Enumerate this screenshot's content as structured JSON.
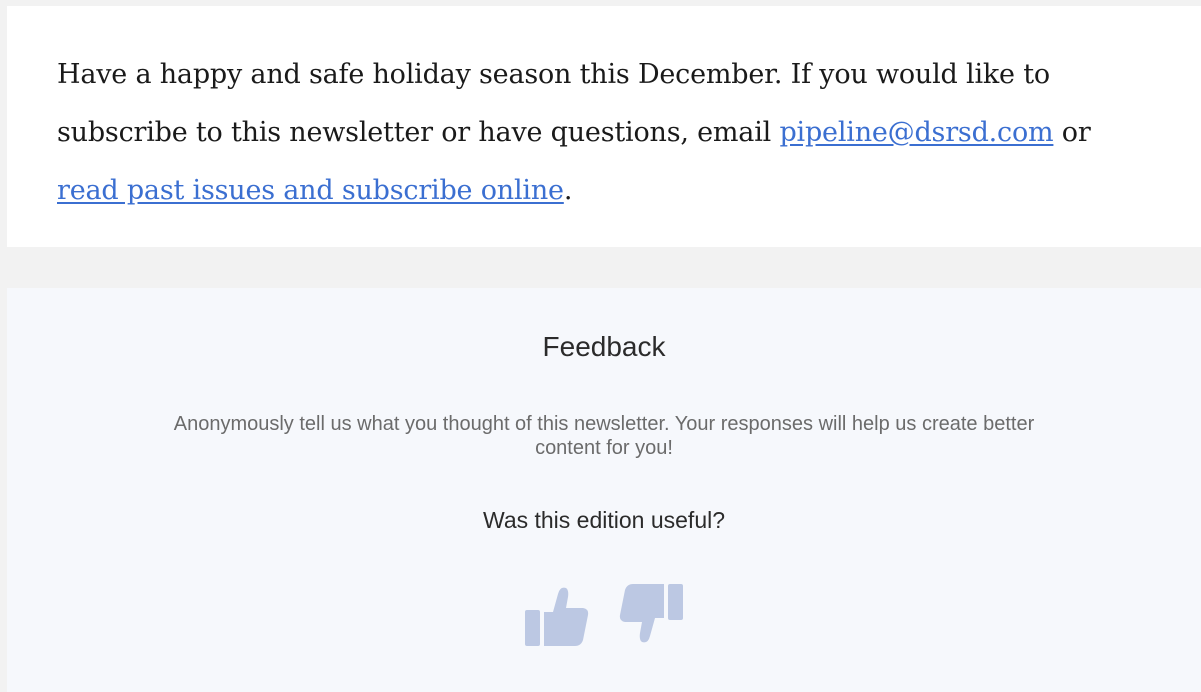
{
  "message": {
    "text_before_email": "Have a happy and safe holiday season this December. If you would like to subscribe to this newsletter or have questions, email ",
    "email_link": "pipeline@dsrsd.com",
    "text_between": " or ",
    "archive_link": "read past issues and subscribe online",
    "text_after": "."
  },
  "feedback": {
    "title": "Feedback",
    "description": "Anonymously tell us what you thought of this newsletter. Your responses will help us create better content for you!",
    "question": "Was this edition useful?",
    "thumbs_up_icon": "thumbs-up-icon",
    "thumbs_down_icon": "thumbs-down-icon"
  },
  "colors": {
    "page_background": "#f2f2f2",
    "link": "#3b6fd1",
    "feedback_background": "#f6f8fc",
    "icon": "#bcc8e3"
  }
}
